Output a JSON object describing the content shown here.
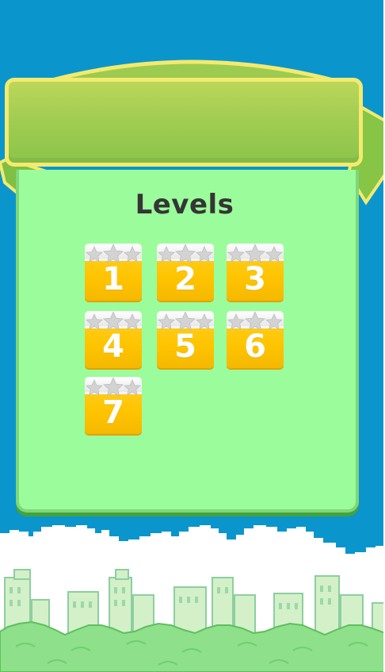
{
  "screen": {
    "title": "Levels",
    "levels": [
      {
        "label": "1",
        "stars": 3
      },
      {
        "label": "2",
        "stars": 3
      },
      {
        "label": "3",
        "stars": 3
      },
      {
        "label": "4",
        "stars": 3
      },
      {
        "label": "5",
        "stars": 3
      },
      {
        "label": "6",
        "stars": 3
      },
      {
        "label": "7",
        "stars": 3
      }
    ]
  },
  "colors": {
    "sky": "#0a96cc",
    "panel": "#9bfc9c",
    "banner": "#9ccb50",
    "banner_border": "#f3ea6f",
    "tile": "#ffc400",
    "ground": "#8fe08a",
    "buildings": "#cfeec3"
  },
  "icons": {
    "star": "star-icon"
  }
}
